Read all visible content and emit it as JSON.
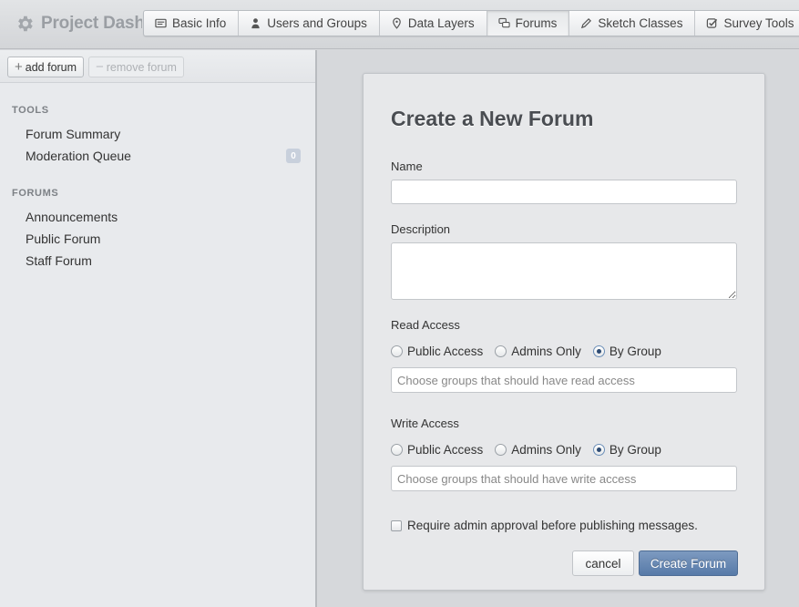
{
  "header": {
    "brand_title": "Project Dashboard",
    "brand_icon": "gear-icon",
    "tabs": [
      {
        "label": "Basic Info",
        "icon": "card-icon"
      },
      {
        "label": "Users and Groups",
        "icon": "user-icon"
      },
      {
        "label": "Data Layers",
        "icon": "map-pin-icon"
      },
      {
        "label": "Forums",
        "icon": "chat-icon",
        "active": true
      },
      {
        "label": "Sketch Classes",
        "icon": "pencil-icon"
      },
      {
        "label": "Survey Tools",
        "icon": "check-square-icon"
      }
    ]
  },
  "sidebar": {
    "add_label": "add forum",
    "remove_label": "remove forum",
    "tools_header": "TOOLS",
    "tools": [
      {
        "label": "Forum Summary"
      },
      {
        "label": "Moderation Queue",
        "badge": "0"
      }
    ],
    "forums_header": "FORUMS",
    "forums": [
      {
        "label": "Announcements"
      },
      {
        "label": "Public Forum"
      },
      {
        "label": "Staff Forum"
      }
    ]
  },
  "form": {
    "title": "Create a New Forum",
    "name_label": "Name",
    "name_value": "",
    "description_label": "Description",
    "description_value": "",
    "read_access": {
      "label": "Read Access",
      "options": [
        "Public Access",
        "Admins Only",
        "By Group"
      ],
      "selected": "By Group",
      "placeholder": "Choose groups that should have read access"
    },
    "write_access": {
      "label": "Write Access",
      "options": [
        "Public Access",
        "Admins Only",
        "By Group"
      ],
      "selected": "By Group",
      "placeholder": "Choose groups that should have write access"
    },
    "approval_label": "Require admin approval before publishing messages.",
    "approval_checked": false,
    "cancel_label": "cancel",
    "submit_label": "Create Forum"
  },
  "colors": {
    "primary_button": "#577aa8",
    "background": "#d6d8db",
    "sidebar": "#e8eaed"
  }
}
